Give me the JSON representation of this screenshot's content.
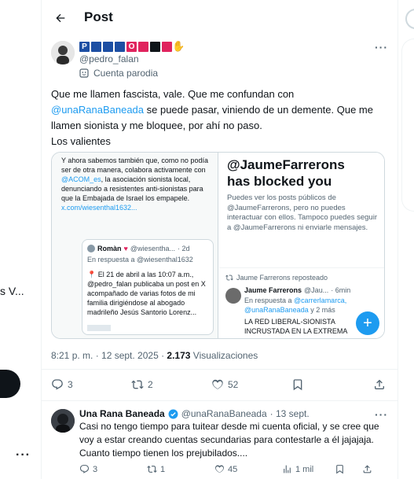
{
  "header": {
    "title": "Post"
  },
  "left_sliver": {
    "truncated_text": "s V..."
  },
  "post": {
    "author_name_blocks": [
      {
        "glyph": "P",
        "color": "#1d4fa3"
      },
      {
        "glyph": "",
        "color": "#1d4fa3"
      },
      {
        "glyph": "",
        "color": "#1d4fa3"
      },
      {
        "glyph": "",
        "color": "#1d4fa3"
      },
      {
        "glyph": "O",
        "color": "#e0245e"
      },
      {
        "glyph": "",
        "color": "#e0245e"
      },
      {
        "glyph": "",
        "color": "#0f1419"
      },
      {
        "glyph": "",
        "color": "#e0245e"
      },
      {
        "glyph": "✋",
        "color": "#ffffff"
      }
    ],
    "handle": "@pedro_falan",
    "parody_label": "Cuenta parodia",
    "text_part1": "Que me llamen fascista, vale. Que me confundan con ",
    "mention": "@unaRanaBaneada",
    "text_part2": " se puede pasar, viniendo de un demente. Que me llamen sionista y me bloquee, por ahí no paso.",
    "text_line_last": "Los valientes",
    "timestamp": "8:21 p. m. · 12 sept. 2025 · ",
    "views_count": "2.173",
    "views_label": " Visualizaciones",
    "replies": "3",
    "reposts": "2",
    "likes": "52"
  },
  "media_left": {
    "intro_1": "Y ahora sabemos también que, como no podía ser de otra manera, colabora activamente con ",
    "intro_mention": "@ACOM_es",
    "intro_2": ", la asociación sionista local, denunciando a resistentes anti-sionistas para que la Embajada de Israel los empapele. ",
    "intro_link": "x.com/wiesenthal1632...",
    "card_name": "Romàn",
    "card_handle": "@wiesentha...",
    "card_time": "· 2d",
    "card_reply": "En respuesta a @wiesenthal1632",
    "card_text": "El 21 de abril a las 10:07 a.m., @pedro_falan publicaba un post en X acompañado de varias fotos de mi familia dirigiéndose al abogado madrileño Jesús Santorio Lorenz..."
  },
  "media_right": {
    "title_handle": "@JaumeFarrerons",
    "title_rest": "has blocked you",
    "description": "Puedes ver los posts públicos de @JaumeFarrerons, pero no puedes interactuar con ellos. Tampoco puedes seguir a @JaumeFarrerons ni enviarle mensajes.",
    "repost_label": "Jaume Farrerons reposteado",
    "inner_name": "Jaume Farrerons",
    "inner_handle": "@Jau...",
    "inner_time": "· 6min",
    "inner_reply_prefix": "En respuesta a ",
    "inner_reply_mentions": "@carrerlamarca, @unaRanaBaneada",
    "inner_reply_suffix": " y 2 más",
    "inner_caps": "LA RED LIBERAL-SIONISTA INCRUSTADA EN LA EXTREMA"
  },
  "reply": {
    "name": "Una Rana Baneada",
    "handle": "@unaRanaBaneada",
    "date": "· 13 sept.",
    "text": "Casi no tengo tiempo para tuitear desde mi cuenta oficial, y se cree que voy a estar creando cuentas secundarias para contestarle a él jajajaja. Cuanto tiempo tienen los prejubilados....",
    "replies": "3",
    "reposts": "1",
    "likes": "45",
    "views": "1 mil"
  }
}
